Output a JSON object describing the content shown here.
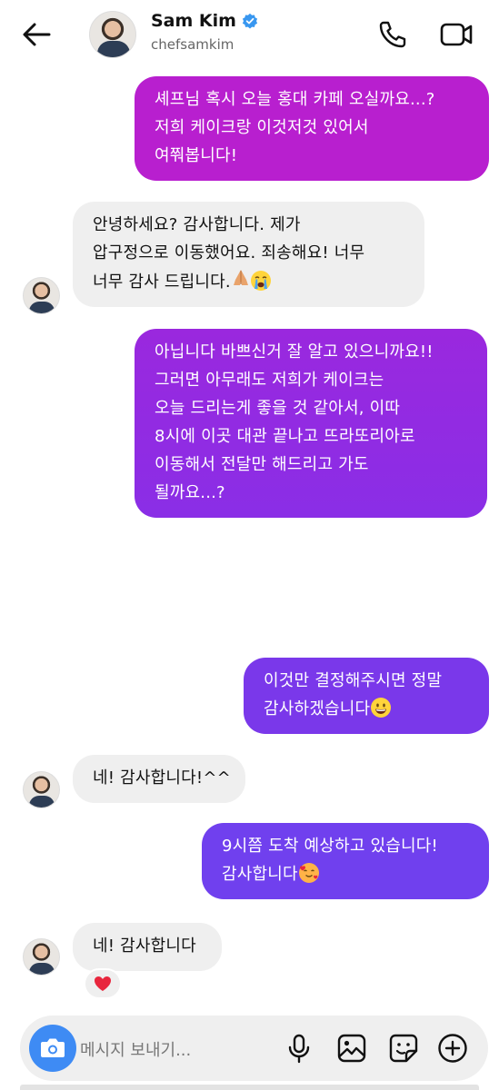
{
  "header": {
    "name": "Sam Kim",
    "handle": "chefsamkim",
    "icons": [
      "back-arrow-icon",
      "verified-badge-icon",
      "phone-icon",
      "video-camera-icon"
    ]
  },
  "messages": [
    {
      "side": "outgoing",
      "lines": [
        "셰프님 혹시 오늘 홍대 카페 오실까요...?",
        "저희 케이크랑 이것저것 있어서",
        "여쭤봅니다!"
      ]
    },
    {
      "side": "incoming",
      "lines": [
        "안녕하세요? 감사합니다. 제가",
        "압구정으로 이동했어요. 죄송해요! 너무",
        "너무 감사 드립니다."
      ],
      "emojis": [
        "folded-hands",
        "crying-face"
      ]
    },
    {
      "side": "outgoing",
      "lines": [
        "아닙니다 바쁘신거 잘 알고 있으니까요!!",
        "그러면 아무래도 저희가 케이크는",
        "오늘 드리는게 좋을 것 같아서, 이따",
        "8시에 이곳 대관 끝나고 뜨라또리아로",
        "이동해서 전달만 해드리고 가도",
        "될까요...?"
      ]
    },
    {
      "side": "outgoing",
      "lines": [
        "이것만 결정해주시면 정말",
        "감사하겠습니다"
      ],
      "emojis": [
        "grinning-face"
      ]
    },
    {
      "side": "incoming",
      "lines": [
        "네! 감사합니다!^^"
      ]
    },
    {
      "side": "outgoing",
      "lines": [
        "9시쯤 도착 예상하고 있습니다!",
        "감사합니다"
      ],
      "emojis": [
        "smiling-face-with-hearts"
      ]
    },
    {
      "side": "incoming",
      "lines": [
        "네! 감사합니다"
      ],
      "reaction": "heart"
    }
  ],
  "composer": {
    "placeholder": "메시지 보내기...",
    "icons": [
      "camera-icon",
      "microphone-icon",
      "gallery-icon",
      "sticker-icon",
      "plus-icon"
    ]
  },
  "colors": {
    "outgoing_1": "#b81fcf",
    "outgoing_2": "#9a28de",
    "outgoing_3": "#7a38ea",
    "outgoing_4": "#7040ee",
    "incoming": "#efefef",
    "camera_button": "#3e8bf4",
    "verified": "#3897f0",
    "reaction_heart": "#e8263d"
  }
}
